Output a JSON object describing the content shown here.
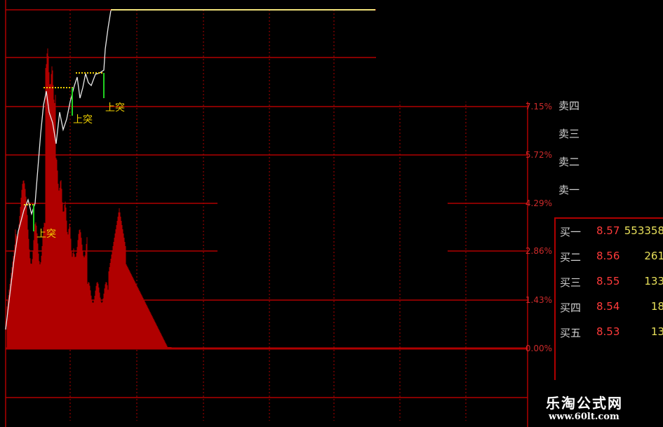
{
  "chart_data": {
    "type": "line",
    "axis_percent_labels": [
      "7.15%",
      "5.72%",
      "4.29%",
      "2.86%",
      "1.43%",
      "0.00%"
    ],
    "breakout_label": "上突",
    "price_line_description": "intraday price line rising from 0% to limit-up plateau",
    "annotations": [
      {
        "label": "上突",
        "x_index": 46,
        "y_pct": 2.9
      },
      {
        "label": "上突",
        "x_index": 101,
        "y_pct": 5.2
      },
      {
        "label": "上突",
        "x_index": 146,
        "y_pct": 6.5
      }
    ]
  },
  "orderbook": {
    "sell": [
      {
        "label": "卖四"
      },
      {
        "label": "卖三"
      },
      {
        "label": "卖二"
      },
      {
        "label": "卖一"
      }
    ],
    "buy": [
      {
        "label": "买一",
        "price": "8.57",
        "volume": "553358"
      },
      {
        "label": "买二",
        "price": "8.56",
        "volume": "261"
      },
      {
        "label": "买三",
        "price": "8.55",
        "volume": "133"
      },
      {
        "label": "买四",
        "price": "8.54",
        "volume": "18"
      },
      {
        "label": "买五",
        "price": "8.53",
        "volume": "13"
      }
    ]
  },
  "watermark": {
    "title": "乐淘公式网",
    "url": "www.60lt.com"
  },
  "colors": {
    "background": "#000000",
    "grid": "#b00000",
    "price_line": "#e8e8e8",
    "limit_line": "#f0e27a",
    "bars": "#b00000",
    "breakout": "#f0d000",
    "marker": "#20d020"
  }
}
